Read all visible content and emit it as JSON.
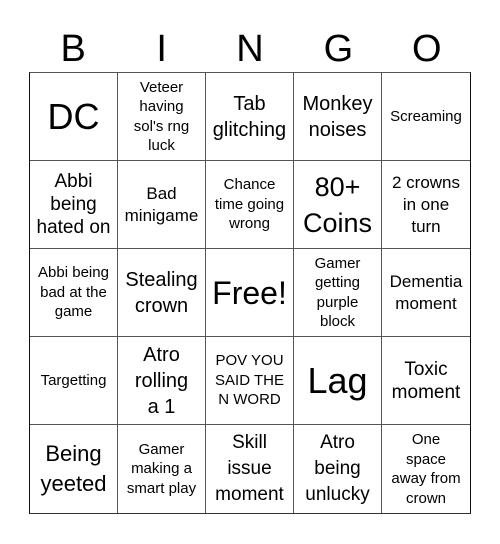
{
  "header": {
    "letters": [
      "B",
      "I",
      "N",
      "G",
      "O"
    ]
  },
  "card": {
    "cells": [
      "DC",
      "Veteer having sol's rng luck",
      "Tab glitching",
      "Monkey noises",
      "Screaming",
      "Abbi being hated on",
      "Bad minigame",
      "Chance time going wrong",
      "80+ Coins",
      "2 crowns in one turn",
      "Abbi being bad at the game",
      "Stealing crown",
      "Free!",
      "Gamer getting purple block",
      "Dementia moment",
      "Targetting",
      "Atro rolling a 1",
      "POV YOU SAID THE N WORD",
      "Lag",
      "Toxic moment",
      "Being yeeted",
      "Gamer making a smart play",
      "Skill issue moment",
      "Atro being unlucky",
      "One space away from crown"
    ]
  },
  "colors": {
    "text": "#000000",
    "border": "#555555",
    "background": "#ffffff"
  }
}
